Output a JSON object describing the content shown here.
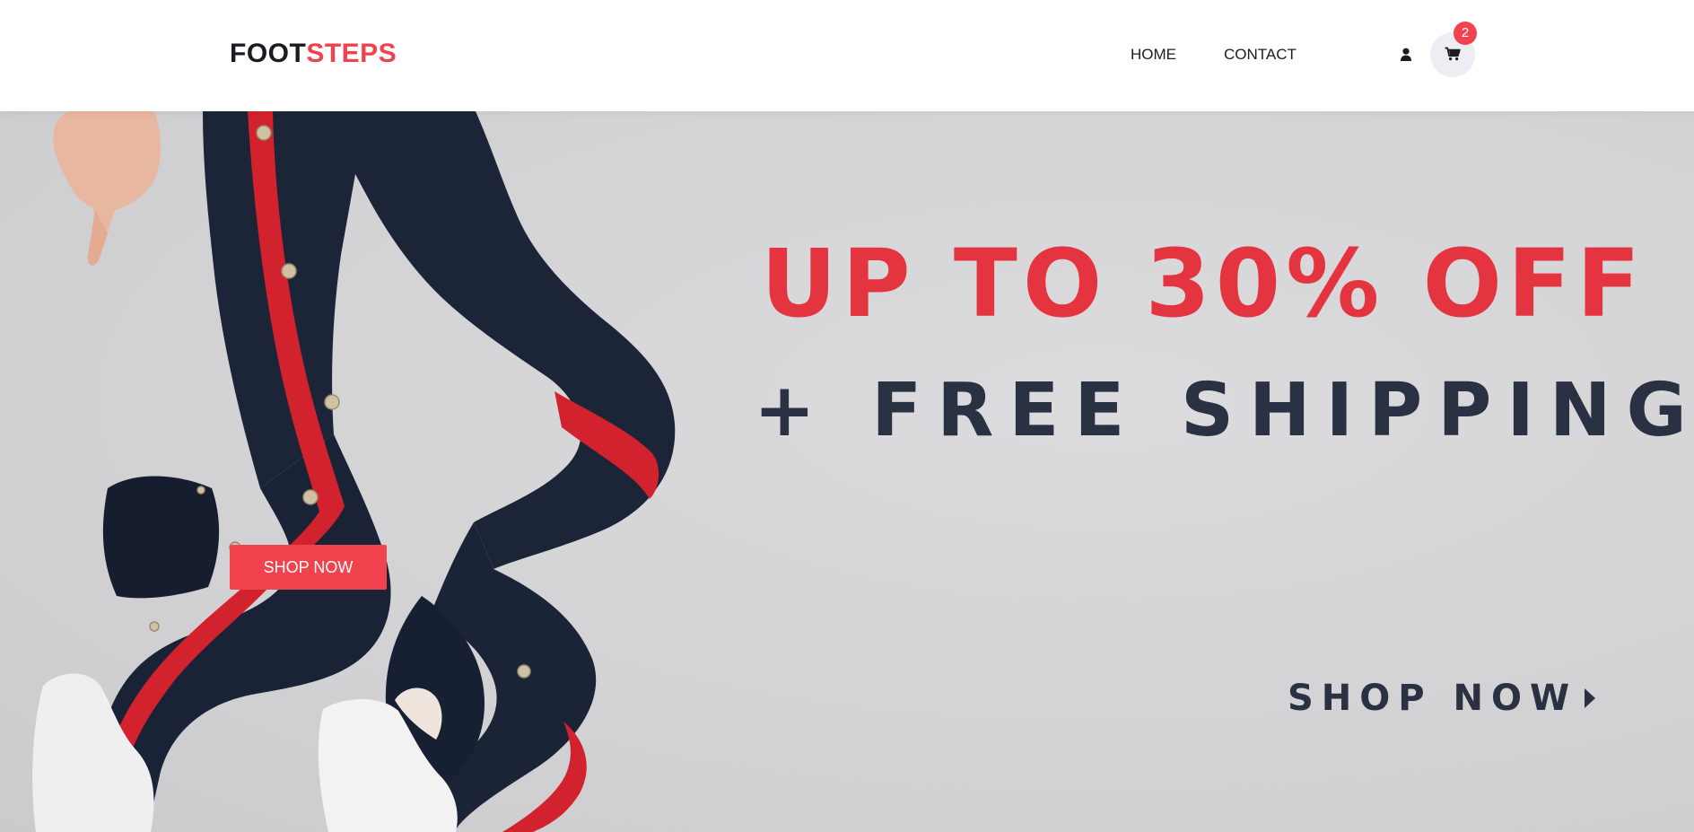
{
  "brand": {
    "part1": "FOOT",
    "part2": "STEPS"
  },
  "nav": {
    "home": "HOME",
    "contact": "CONTACT"
  },
  "icons": {
    "user": "user-icon",
    "cart": "cart-icon",
    "arrow": "caret-right-icon"
  },
  "cart": {
    "count": "2"
  },
  "hero": {
    "headline_offer": "UP TO 30% OFF",
    "headline_shipping": "+ FREE SHIPPING",
    "cta_link": "SHOP NOW",
    "cta_button": "SHOP NOW"
  },
  "colors": {
    "accent": "#f0434d",
    "headline_red": "#e3343f",
    "dark_text": "#2a3142",
    "hero_bg": "#d6d6d8"
  }
}
